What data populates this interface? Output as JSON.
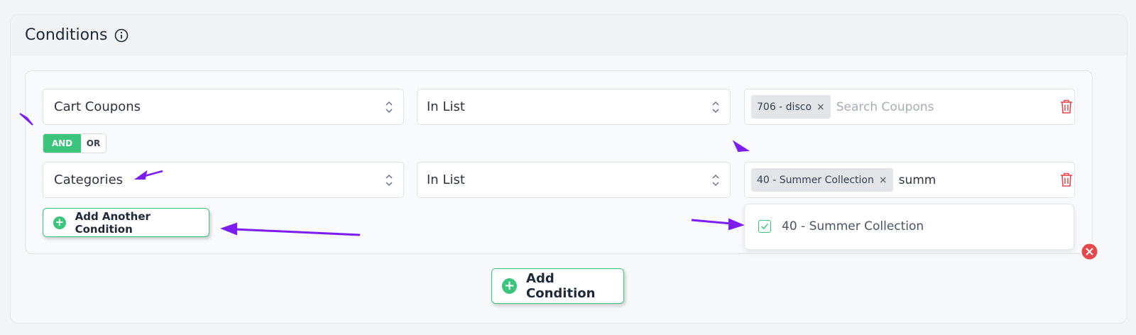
{
  "panel": {
    "title": "Conditions"
  },
  "rows": [
    {
      "type": "Cart Coupons",
      "operator": "In List",
      "tag": "706 - disco",
      "tag_remove": "×",
      "search_placeholder": "Search Coupons"
    },
    {
      "type": "Categories",
      "operator": "In List",
      "tag": "40 - Summer Collection",
      "tag_remove": "×",
      "search_value": "summ"
    }
  ],
  "logic": {
    "and_label": "AND",
    "or_label": "OR",
    "selected": "AND"
  },
  "buttons": {
    "add_another": "Add Another Condition",
    "add_condition": "Add Condition",
    "plus": "+"
  },
  "dropdown": {
    "options": [
      {
        "label": "40 - Summer Collection",
        "checked": true
      }
    ]
  },
  "colors": {
    "accent": "#3bc47b",
    "danger": "#e5484d",
    "annotation_arrow": "#7c1df2"
  }
}
